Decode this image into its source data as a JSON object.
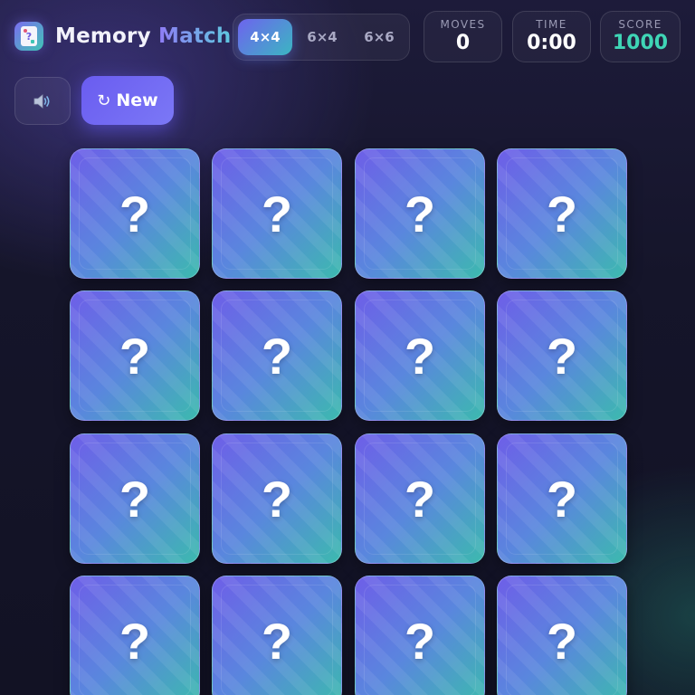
{
  "header": {
    "logo_icon": "card-stack-icon",
    "title_part1": "Memory",
    "title_part2": "Match",
    "grid_sizes": [
      {
        "label": "4×4",
        "active": true
      },
      {
        "label": "6×4",
        "active": false
      },
      {
        "label": "6×6",
        "active": false
      }
    ],
    "stats": {
      "moves": {
        "label": "MOVES",
        "value": "0"
      },
      "time": {
        "label": "TIME",
        "value": "0:00"
      },
      "score": {
        "label": "SCORE",
        "value": "1000"
      }
    }
  },
  "actions": {
    "sound_icon": "speaker-icon",
    "new_label": "New",
    "new_icon": "refresh-icon"
  },
  "board": {
    "rows": 4,
    "cols": 4,
    "card_face_down_symbol": "?",
    "cards": [
      "?",
      "?",
      "?",
      "?",
      "?",
      "?",
      "?",
      "?",
      "?",
      "?",
      "?",
      "?",
      "?",
      "?",
      "?",
      "?"
    ]
  },
  "colors": {
    "accent_purple": "#6e5ee8",
    "accent_teal": "#3cbaae",
    "score_color": "#3fd6b6",
    "background": "#15152a"
  }
}
